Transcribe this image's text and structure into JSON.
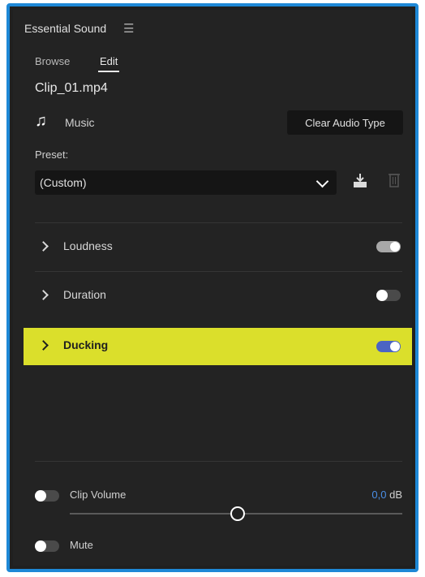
{
  "panel": {
    "title": "Essential Sound"
  },
  "tabs": [
    {
      "label": "Browse"
    },
    {
      "label": "Edit",
      "active": true
    }
  ],
  "clip": {
    "name": "Clip_01.mp4"
  },
  "audio_type": {
    "label": "Music",
    "clear_button": "Clear Audio Type"
  },
  "preset": {
    "label": "Preset:",
    "value": "(Custom)"
  },
  "sections": [
    {
      "label": "Loudness",
      "enabled": true
    },
    {
      "label": "Duration",
      "enabled": false
    },
    {
      "label": "Ducking",
      "enabled": true,
      "highlighted": true
    }
  ],
  "clip_volume": {
    "label": "Clip Volume",
    "value": "0,0",
    "unit": "dB",
    "enabled": false,
    "slider_position": 0.5
  },
  "mute": {
    "label": "Mute",
    "enabled": false
  },
  "colors": {
    "accent": "#4a8fe7",
    "highlight": "#dbdf2b",
    "toggle_on": "#4b64c4",
    "frame_border": "#1e88d6"
  },
  "icons": {
    "menu": "hamburger-icon",
    "music": "music-note-icon",
    "preset_dropdown": "chevron-down-icon",
    "save_preset": "save-preset-icon",
    "delete_preset": "trash-icon",
    "section_expand": "chevron-right-icon"
  }
}
